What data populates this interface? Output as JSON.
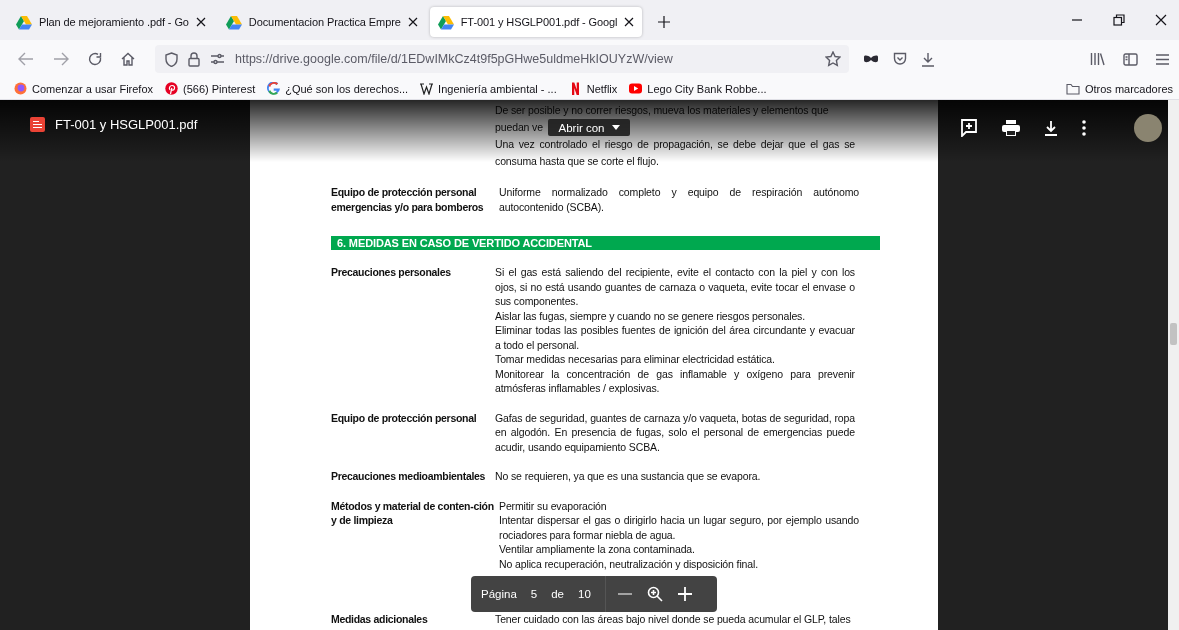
{
  "tabs": [
    {
      "title": "Plan de mejoramiento .pdf - Go",
      "selected": false
    },
    {
      "title": "Documentacion Practica Empre",
      "selected": false
    },
    {
      "title": "FT-001 y HSGLP001.pdf - Googl",
      "selected": true
    }
  ],
  "address_bar": {
    "url": "https://drive.google.com/file/d/1EDwIMkCz4t9f5pGHwe5uldmeHkIOUYzW/view"
  },
  "bookmarks": [
    {
      "kind": "firefox",
      "label": "Comenzar a usar Firefox"
    },
    {
      "kind": "pinterest",
      "label": "(566) Pinterest"
    },
    {
      "kind": "google",
      "label": "¿Qué son los derechos..."
    },
    {
      "kind": "wikipedia",
      "label": "Ingeniería ambiental - ..."
    },
    {
      "kind": "netflix",
      "label": "Netflix"
    },
    {
      "kind": "youtube",
      "label": "Lego City Bank Robbe..."
    }
  ],
  "other_bookmarks": "Otros marcadores",
  "viewer": {
    "file_name": "FT-001 y HSGLP001.pdf",
    "open_with": "Abrir con"
  },
  "document": {
    "intro": [
      "De ser posible y no correr riesgos, mueva los materiales y elementos que",
      "puedan ve",
      "Una vez controlado el riesgo de propagación, se debe dejar que el gas se consuma hasta que se corte el flujo."
    ],
    "blocks": [
      {
        "kind": "row",
        "label": "Equipo de protección personal emergencias y/o para bomberos",
        "paragraphs": [
          "Uniforme normalizado completo y equipo de respiración autónomo autocontenido (SCBA)."
        ]
      },
      {
        "kind": "heading",
        "text": "6. MEDIDAS EN CASO DE VERTIDO ACCIDENTAL"
      },
      {
        "kind": "row",
        "label": "Precauciones personales",
        "paragraphs": [
          "Si el gas está saliendo del recipiente, evite el contacto con la piel y con los ojos, si no está usando guantes de carnaza o vaqueta, evite tocar el envase o sus componentes.",
          "Aislar las fugas, siempre y cuando no se genere riesgos personales.",
          "Eliminar todas las posibles fuentes de ignición del área circundante y evacuar a todo el personal.",
          "Tomar medidas necesarias para eliminar electricidad estática.",
          "Monitorear la concentración de gas inflamable y oxígeno para prevenir atmósferas inflamables / explosivas."
        ]
      },
      {
        "kind": "row",
        "label": "Equipo de protección personal",
        "paragraphs": [
          "Gafas de seguridad, guantes de carnaza y/o vaqueta, botas de seguridad, ropa en algodón. En presencia de fugas, solo el personal de emergencias puede acudir, usando equipamiento SCBA."
        ]
      },
      {
        "kind": "row",
        "label": "Precauciones medioambientales",
        "paragraphs": [
          "No se requieren, ya que es una sustancia que se evapora."
        ]
      },
      {
        "kind": "row",
        "label": "Métodos y material de conten-ción y de limpieza",
        "paragraphs": [
          "Permitir su evaporación",
          "Intentar dispersar el gas o dirigirlo hacia un lugar seguro, por ejemplo usando rociadores para formar niebla de agua.",
          "Ventilar ampliamente la zona contaminada.",
          "No aplica recuperación, neutralización y disposición final."
        ]
      },
      {
        "kind": "row",
        "label": "Medidas adicionales",
        "paragraphs": [
          "Tener cuidado con las áreas bajo nivel donde se pueda acumular el GLP, tales"
        ]
      }
    ]
  },
  "page_controls": {
    "label": "Página",
    "current": "5",
    "separator": "de",
    "total": "10"
  }
}
